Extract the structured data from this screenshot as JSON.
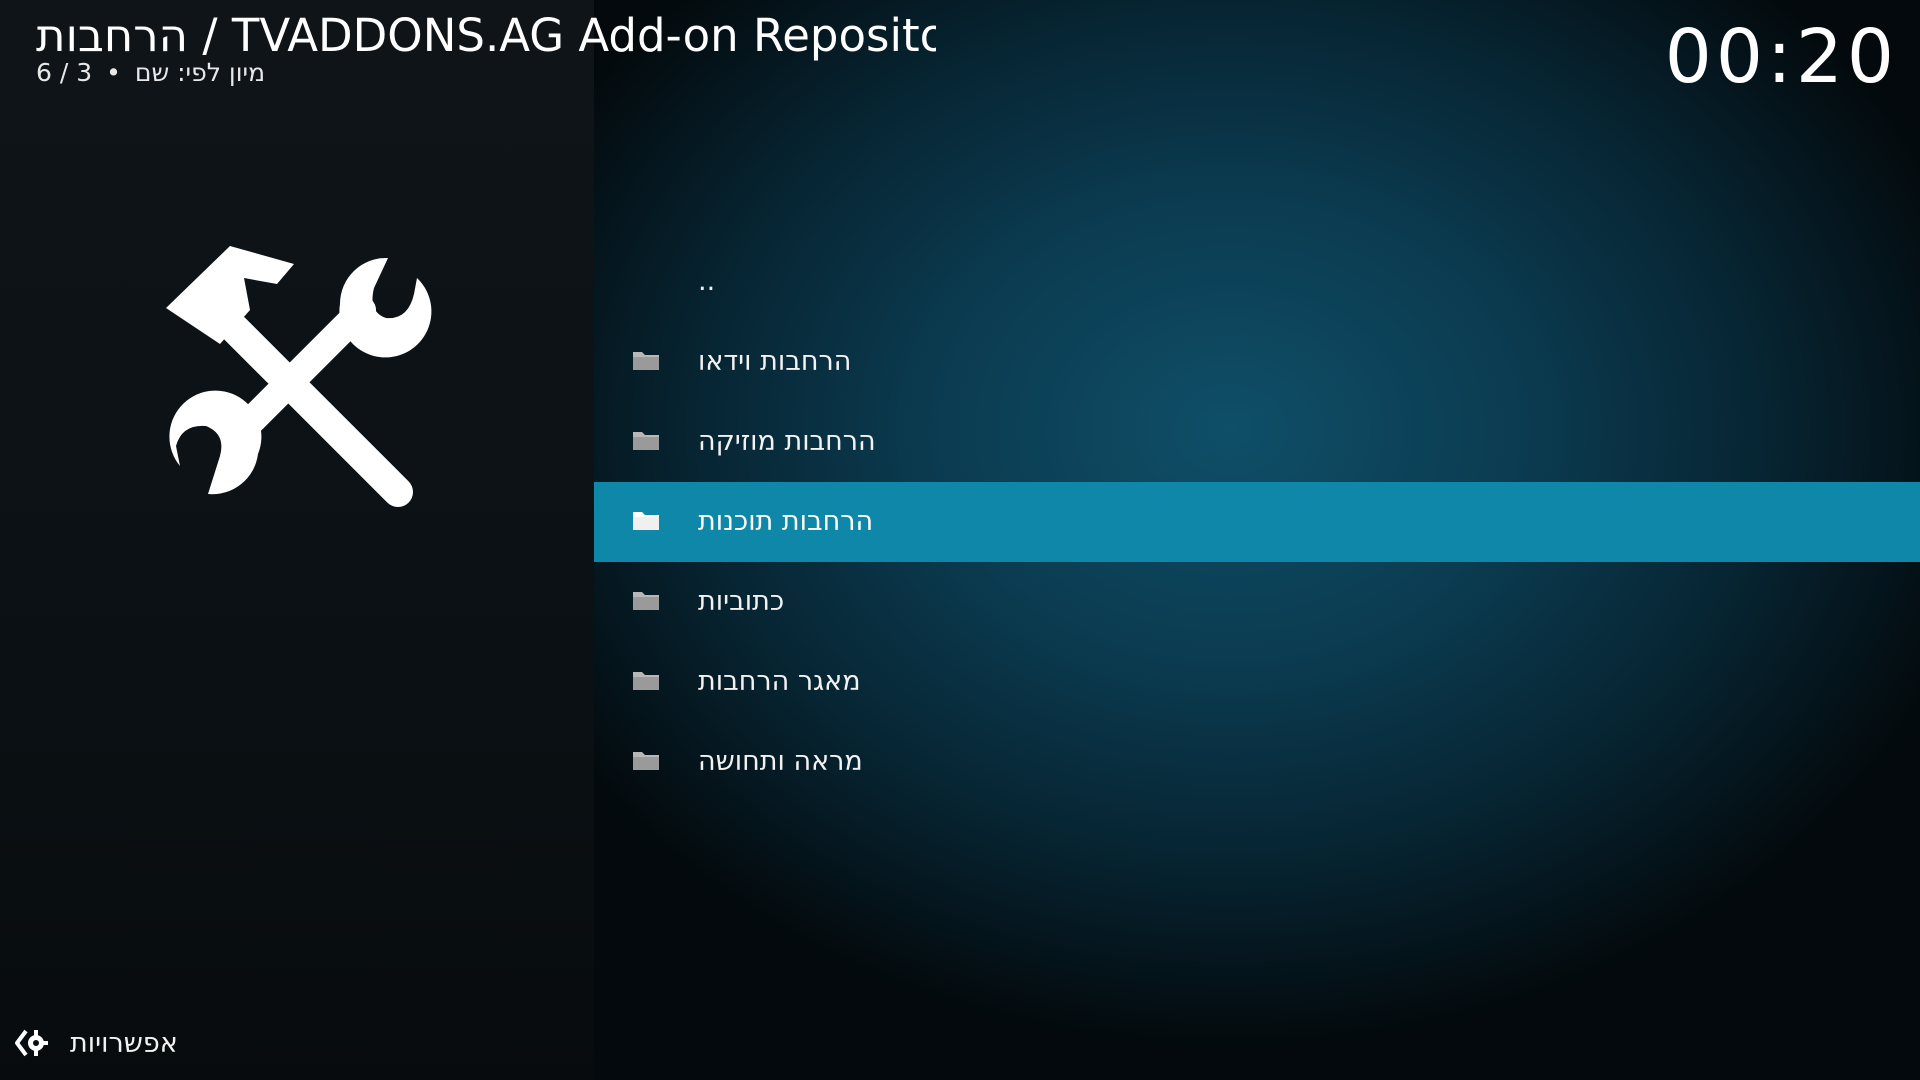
{
  "header": {
    "title": "הרחבות / TVADDONS.AG Add-on Repository",
    "sort_label": "מיון לפי: שם",
    "separator": "•",
    "position": "6 / 3"
  },
  "clock": "00:20",
  "side_icon": "tools-hammer-wrench-icon",
  "list": {
    "items": [
      {
        "label": "..",
        "icon": "none",
        "selected": false
      },
      {
        "label": "הרחבות וידאו",
        "icon": "folder-icon",
        "selected": false
      },
      {
        "label": "הרחבות מוזיקה",
        "icon": "folder-icon",
        "selected": false
      },
      {
        "label": "הרחבות תוכנות",
        "icon": "folder-icon",
        "selected": true
      },
      {
        "label": "כתוביות",
        "icon": "folder-icon",
        "selected": false
      },
      {
        "label": "מאגר הרחבות",
        "icon": "folder-icon",
        "selected": false
      },
      {
        "label": "מראה ותחושה",
        "icon": "folder-icon",
        "selected": false
      }
    ]
  },
  "options": {
    "label": "אפשרויות",
    "icon": "options-gear-icon"
  },
  "colors": {
    "selection": "#0f87a8",
    "left_panel": "#0e1418",
    "background": "#0b3b50",
    "folder_unselected": "#b8b8b8",
    "folder_selected": "#ffffff"
  }
}
